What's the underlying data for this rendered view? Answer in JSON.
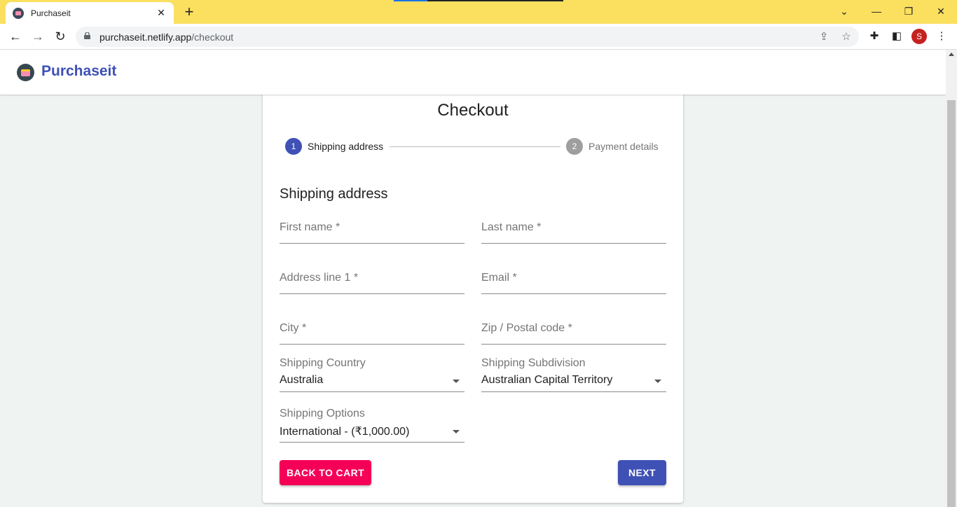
{
  "browser": {
    "tab_title": "Purchaseit",
    "tab_close": "✕",
    "new_tab": "+",
    "url_host": "purchaseit.netlify.app",
    "url_path": "/checkout",
    "avatar_letter": "S",
    "window_controls": {
      "minimize": "—",
      "restore": "❐",
      "close": "✕",
      "tab_search": "⌄"
    },
    "nav": {
      "back": "←",
      "forward": "→",
      "reload": "↻"
    },
    "icons": {
      "share": "⇪",
      "bookmark": "☆",
      "extensions": "✚",
      "side_panel": "◧",
      "menu": "⋮"
    },
    "colors": {
      "titlebar": "#fbdf5f",
      "avatar": "#c5221f"
    }
  },
  "app": {
    "name": "Purchaseit",
    "brand_color": "#3f51b5"
  },
  "checkout": {
    "title": "Checkout",
    "steps": [
      {
        "number": "1",
        "label": "Shipping address",
        "active": true
      },
      {
        "number": "2",
        "label": "Payment details",
        "active": false
      }
    ],
    "section_title": "Shipping address",
    "fields": {
      "first_name": "First name *",
      "last_name": "Last name *",
      "address_line1": "Address line 1 *",
      "email": "Email *",
      "city": "City *",
      "zip": "Zip / Postal code *"
    },
    "selects": {
      "country": {
        "label": "Shipping Country",
        "value": "Australia"
      },
      "subdivision": {
        "label": "Shipping Subdivision",
        "value": "Australian Capital Territory"
      },
      "options": {
        "label": "Shipping Options",
        "value": "International - (₹1,000.00)"
      }
    },
    "buttons": {
      "back": "BACK TO CART",
      "next": "NEXT"
    },
    "colors": {
      "active_step": "#3f51b5",
      "inactive_step": "#9e9e9e",
      "back_button": "#f50057",
      "next_button": "#3f51b5"
    }
  }
}
